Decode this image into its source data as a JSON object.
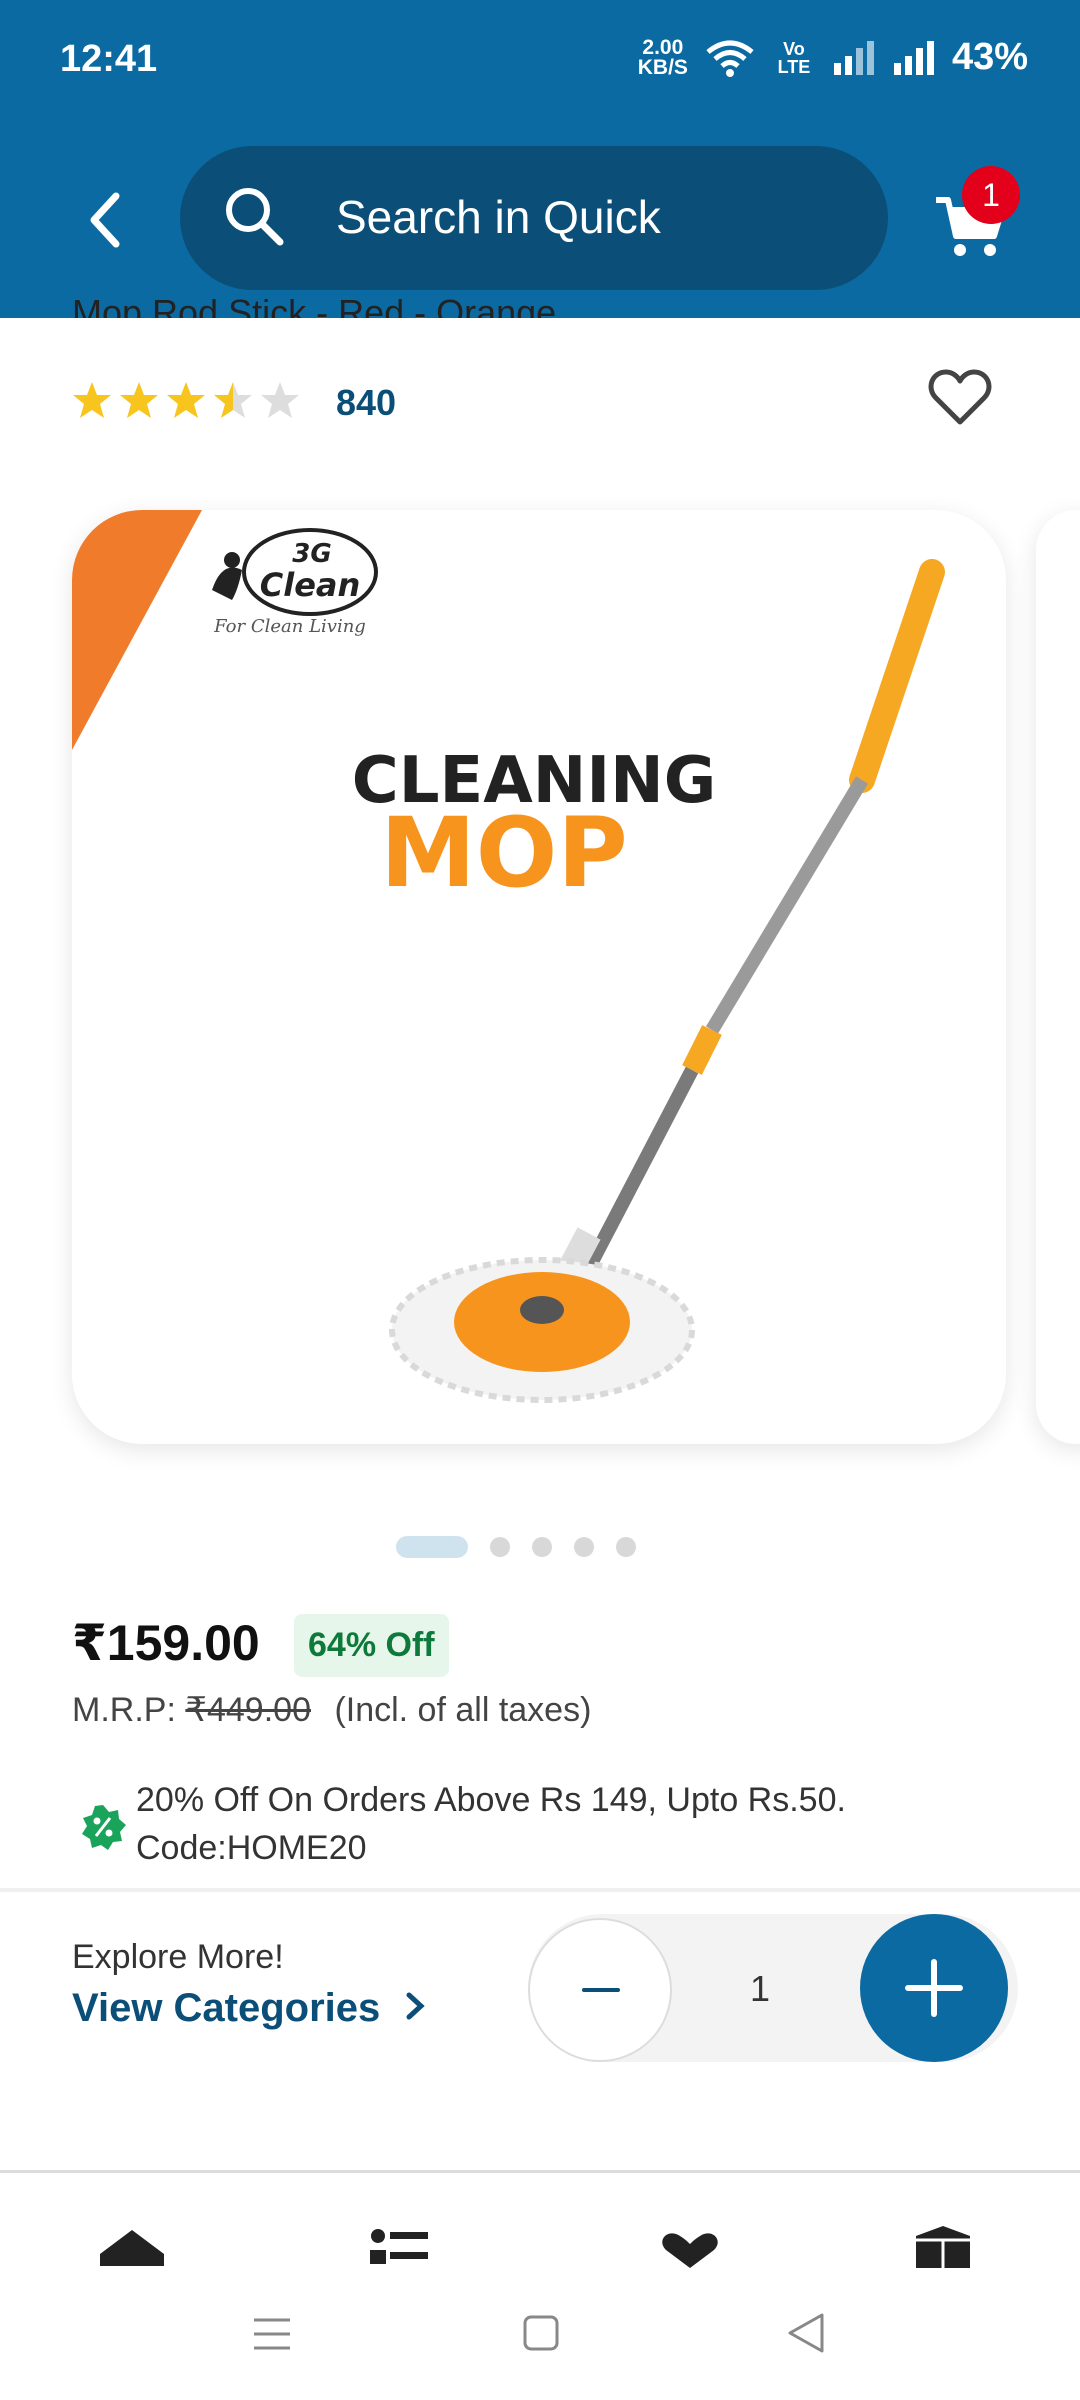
{
  "status_bar": {
    "time": "12:41",
    "speed_value": "2.00",
    "speed_unit": "KB/S",
    "volte": "Vo LTE",
    "battery": "43%"
  },
  "header": {
    "search_placeholder": "Search in Quick",
    "cart_count": "1"
  },
  "product": {
    "title_partial": "Mop Rod Stick - Red - Orange",
    "rating": 3.5,
    "rating_count": "840",
    "image": {
      "brand_top": "3G",
      "brand_bottom": "Clean",
      "brand_tagline": "For Clean Living",
      "headline_1": "CLEANING",
      "headline_2": "MOP"
    },
    "carousel": {
      "total": 5,
      "active_index": 0
    },
    "price": "₹159.00",
    "discount": "64% Off",
    "mrp_label": "M.R.P:",
    "mrp_value": "₹449.00",
    "tax_note": "(Incl. of all taxes)",
    "offer_line1": "20% Off On Orders Above Rs 149, Upto Rs.50.",
    "offer_line2": "Code:HOME20"
  },
  "footer_bar": {
    "explore_label": "Explore More!",
    "view_categories": "View Categories",
    "quantity": "1"
  },
  "colors": {
    "header_bg": "#0b6aa2",
    "search_bg": "#0b4f78",
    "badge": "#e2001a",
    "accent_orange": "#f7941d",
    "discount_green": "#0d7a3b"
  }
}
